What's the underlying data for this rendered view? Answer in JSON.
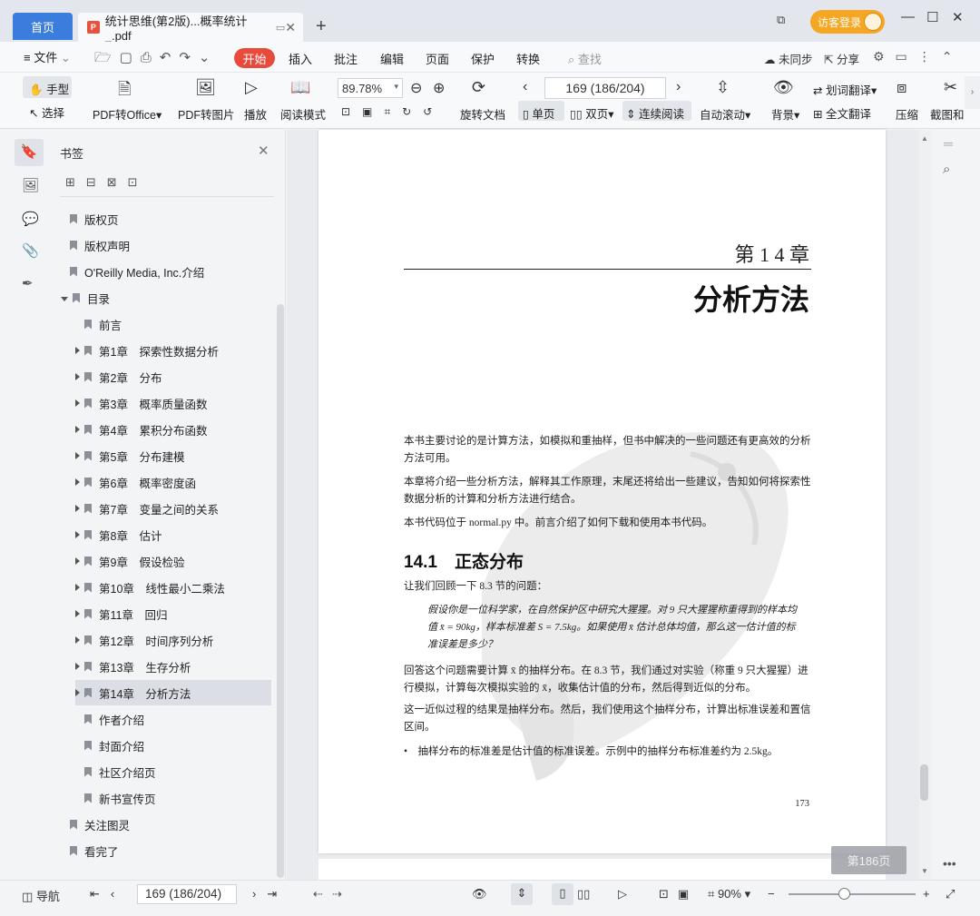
{
  "tabs": {
    "home": "首页",
    "doc_title": "统计思维(第2版)...概率统计_.pdf"
  },
  "header": {
    "guest_login": "访客登录"
  },
  "menu": {
    "file": "文件",
    "items": [
      "开始",
      "插入",
      "批注",
      "编辑",
      "页面",
      "保护",
      "转换"
    ],
    "search": "查找",
    "sync": "未同步",
    "share": "分享"
  },
  "toolbar": {
    "hand": "手型",
    "select": "选择",
    "pdf_to_office": "PDF转Office",
    "pdf_to_image": "PDF转图片",
    "play": "播放",
    "read_mode": "阅读模式",
    "zoom": "89.78%",
    "rotate": "旋转文档",
    "page_value": "169 (186/204)",
    "single": "单页",
    "double": "双页",
    "continuous": "连续阅读",
    "auto_scroll": "自动滚动",
    "background": "背景",
    "translate": "划词翻译",
    "full_translate": "全文翻译",
    "compress": "压缩",
    "screenshot": "截图和"
  },
  "panel": {
    "title": "书签",
    "items": [
      {
        "label": "版权页",
        "level": 0,
        "expand": "none"
      },
      {
        "label": "版权声明",
        "level": 0,
        "expand": "none"
      },
      {
        "label": "O'Reilly Media, Inc.介绍",
        "level": 0,
        "expand": "none"
      },
      {
        "label": "目录",
        "level": 0,
        "expand": "open"
      },
      {
        "label": "前言",
        "level": 1,
        "expand": "none"
      },
      {
        "label": "第1章　探索性数据分析",
        "level": 1,
        "expand": "closed"
      },
      {
        "label": "第2章　分布",
        "level": 1,
        "expand": "closed"
      },
      {
        "label": "第3章　概率质量函数",
        "level": 1,
        "expand": "closed"
      },
      {
        "label": "第4章　累积分布函数",
        "level": 1,
        "expand": "closed"
      },
      {
        "label": "第5章　分布建模",
        "level": 1,
        "expand": "closed"
      },
      {
        "label": "第6章　概率密度函",
        "level": 1,
        "expand": "closed"
      },
      {
        "label": "第7章　变量之间的关系",
        "level": 1,
        "expand": "closed"
      },
      {
        "label": "第8章　估计",
        "level": 1,
        "expand": "closed"
      },
      {
        "label": "第9章　假设检验",
        "level": 1,
        "expand": "closed"
      },
      {
        "label": "第10章　线性最小二乘法",
        "level": 1,
        "expand": "closed"
      },
      {
        "label": "第11章　回归",
        "level": 1,
        "expand": "closed"
      },
      {
        "label": "第12章　时间序列分析",
        "level": 1,
        "expand": "closed"
      },
      {
        "label": "第13章　生存分析",
        "level": 1,
        "expand": "closed"
      },
      {
        "label": "第14章　分析方法",
        "level": 1,
        "expand": "closed",
        "active": true
      },
      {
        "label": "作者介绍",
        "level": 1,
        "expand": "none"
      },
      {
        "label": "封面介绍",
        "level": 1,
        "expand": "none"
      },
      {
        "label": "社区介绍页",
        "level": 1,
        "expand": "none"
      },
      {
        "label": "新书宣传页",
        "level": 1,
        "expand": "none"
      },
      {
        "label": "关注图灵",
        "level": 0,
        "expand": "none"
      },
      {
        "label": "看完了",
        "level": 0,
        "expand": "none"
      }
    ]
  },
  "page": {
    "chapter": "第 1 4 章",
    "chapter_title": "分析方法",
    "p1": "本书主要讨论的是计算方法，如模拟和重抽样，但书中解决的一些问题还有更高效的分析方法可用。",
    "p2": "本章将介绍一些分析方法，解释其工作原理，末尾还将给出一些建议，告知如何将探索性数据分析的计算和分析方法进行结合。",
    "p3": "本书代码位于 normal.py 中。前言介绍了如何下载和使用本书代码。",
    "section": "14.1　正态分布",
    "p4": "让我们回顾一下 8.3 节的问题：",
    "quote": "假设你是一位科学家，在自然保护区中研究大猩猩。对 9 只大猩猩称重得到的样本均值 x̄ = 90kg，样本标准差 S = 7.5kg。如果使用 x̄ 估计总体均值，那么这一估计值的标准误差是多少？",
    "p5": "回答这个问题需要计算 x̄ 的抽样分布。在 8.3 节，我们通过对实验（称重 9 只大猩猩）进行模拟，计算每次模拟实验的 x̄，收集估计值的分布，然后得到近似的分布。",
    "p6": "这一近似过程的结果是抽样分布。然后，我们使用这个抽样分布，计算出标准误差和置信区间。",
    "bullet": "抽样分布的标准差是估计值的标准误差。示例中的抽样分布标准差约为 2.5kg。",
    "page_number": "173"
  },
  "page_tag": "第186页",
  "status": {
    "nav": "导航",
    "page_value": "169 (186/204)",
    "zoom": "90%"
  }
}
